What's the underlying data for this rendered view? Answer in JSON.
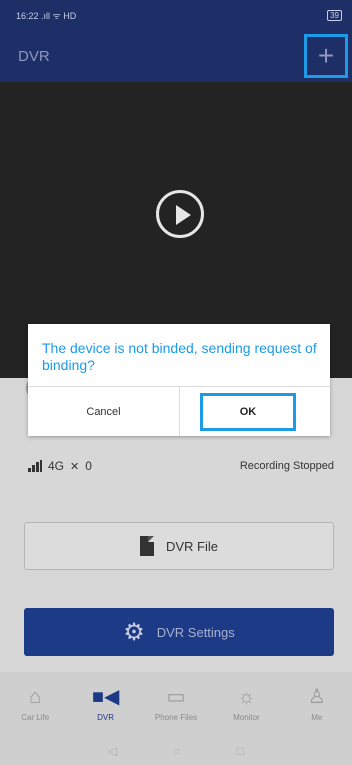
{
  "statusbar": {
    "left": "16:22 .ıll ᯤ HD",
    "right": "39"
  },
  "header": {
    "title": "DVR",
    "add_icon": "plus-icon",
    "add_symbol": "+"
  },
  "video": {
    "play_icon": "play-icon"
  },
  "info": {
    "network": "4G",
    "gps_count": "0",
    "recording_status": "Recording Stopped"
  },
  "buttons": {
    "dvr_file": "DVR File",
    "dvr_settings": "DVR Settings"
  },
  "dialog": {
    "message": "The device is not binded, sending request of binding?",
    "cancel": "Cancel",
    "ok": "OK"
  },
  "nav": {
    "items": [
      {
        "label": "Car Life",
        "icon": "home-icon",
        "glyph": "⌂"
      },
      {
        "label": "DVR",
        "icon": "video-camera-icon",
        "glyph": "■◀"
      },
      {
        "label": "Phone Files",
        "icon": "image-icon",
        "glyph": "▭"
      },
      {
        "label": "Monitor",
        "icon": "bulb-icon",
        "glyph": "☼"
      },
      {
        "label": "Me",
        "icon": "person-icon",
        "glyph": "♙"
      }
    ]
  },
  "colors": {
    "header": "#1d2f66",
    "accent": "#1c9be6",
    "settings": "#1d3a86"
  }
}
